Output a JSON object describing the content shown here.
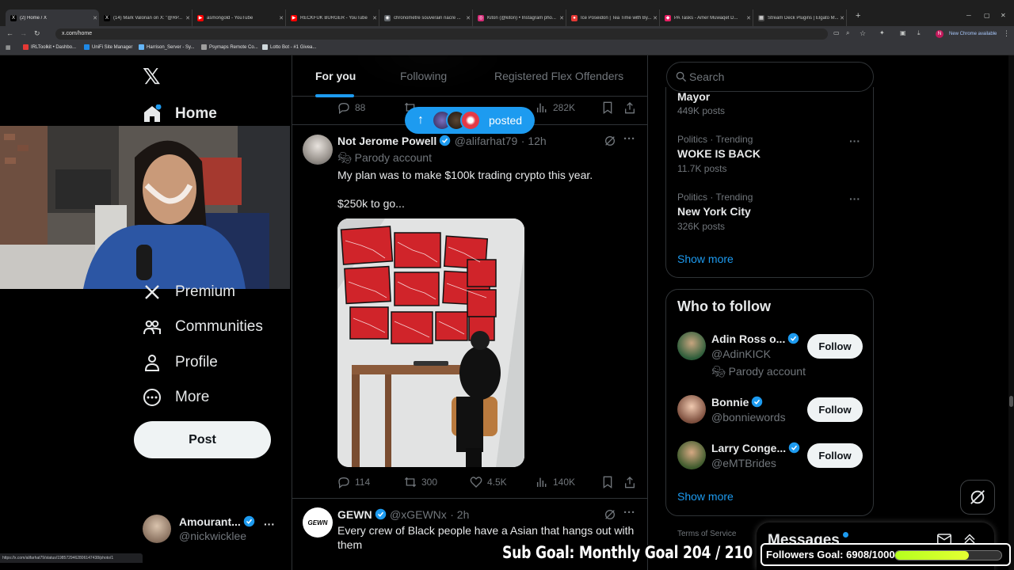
{
  "browser": {
    "tabs": [
      {
        "title": "(2) Home / X",
        "color": "#000000",
        "glyph": "X"
      },
      {
        "title": "(14) Mark Valorian on X: \"@RP...",
        "color": "#000000",
        "glyph": "X"
      },
      {
        "title": "asmongold - YouTube",
        "color": "#ff0000",
        "glyph": "▶"
      },
      {
        "title": "RECKFUK BURGER - YouTube",
        "color": "#ff0000",
        "glyph": "▶"
      },
      {
        "title": "chronomètre souverain nacre ...",
        "color": "#5f6368",
        "glyph": "◉"
      },
      {
        "title": "Kiton (@kiton) • Instagram pho...",
        "color": "#d62976",
        "glyph": "◎"
      },
      {
        "title": "Ice Poseidon | Tea Time with By...",
        "color": "#e53935",
        "glyph": "●"
      },
      {
        "title": "PA Tasks - Amer Muwaqet D...",
        "color": "#e91e63",
        "glyph": "◆"
      },
      {
        "title": "Stream Deck Plugins | Elgato M...",
        "color": "#4a4a4a",
        "glyph": "▦"
      }
    ],
    "url": "x.com/home",
    "new_chrome_label": "New Chrome available",
    "bookmarks": [
      {
        "label": "IRLToolkit • Dashbo...",
        "color": "#e53935"
      },
      {
        "label": "UniFi Site Manager",
        "color": "#1e88e5"
      },
      {
        "label": "Harrison_Server - Sy...",
        "color": "#64b5f6"
      },
      {
        "label": "Psymaps Remote Co...",
        "color": "#9e9e9e"
      },
      {
        "label": "Lotto Bot - #1 Givea...",
        "color": "#cfd8dc"
      }
    ],
    "status_url": "https://x.com/alifarhat79/status/1985729462806147438/photo/1"
  },
  "sidebar": {
    "home_label": "Home",
    "premium_label": "Premium",
    "communities_label": "Communities",
    "profile_label": "Profile",
    "more_label": "More",
    "post_label": "Post",
    "account_name": "Amourant...",
    "account_handle": "@nickwicklee"
  },
  "feed": {
    "tabs": [
      "For you",
      "Following",
      "Registered Flex Offenders"
    ],
    "prev_stats": {
      "replies": "88",
      "views": "282K"
    },
    "posted_pill": "posted",
    "tweet1": {
      "name": "Not Jerome Powell",
      "handle": "@alifarhat79",
      "time": "· 12h",
      "parody": "Parody account",
      "line1": "My plan was to make $100k trading crypto this year.",
      "line2": "$250k to go...",
      "replies": "114",
      "reposts": "300",
      "likes": "4.5K",
      "views": "140K"
    },
    "tweet2": {
      "name": "GEWN",
      "handle": "@xGEWNx",
      "time": "· 2h",
      "text": "Every crew of Black people have a Asian that hangs out with them"
    }
  },
  "right": {
    "search_placeholder": "Search",
    "trends": [
      {
        "context": "",
        "title": "Mayor",
        "count": "449K posts"
      },
      {
        "context": "Politics · Trending",
        "title": "WOKE IS BACK",
        "count": "11.7K posts"
      },
      {
        "context": "Politics · Trending",
        "title": "New York City",
        "count": "326K posts"
      }
    ],
    "show_more": "Show more",
    "who_to_follow_title": "Who to follow",
    "follow_label": "Follow",
    "suggestions": [
      {
        "name": "Adin Ross o...",
        "handle": "@AdinKICK",
        "note": "Parody account"
      },
      {
        "name": "Bonnie",
        "handle": "@bonniewords",
        "note": ""
      },
      {
        "name": "Larry Conge...",
        "handle": "@eMTBrides",
        "note": ""
      }
    ],
    "show_more2": "Show more",
    "footer": "Terms of Service",
    "messages_title": "Messages"
  },
  "overlay": {
    "sub_goal": "Sub Goal: Monthly Goal  204 / 210",
    "followers_goal": "Followers Goal: 6908/10000",
    "followers_progress": 0.6908
  },
  "colors": {
    "accent": "#1d9bf0",
    "bg": "#000000",
    "progress": "#c6ff22"
  }
}
